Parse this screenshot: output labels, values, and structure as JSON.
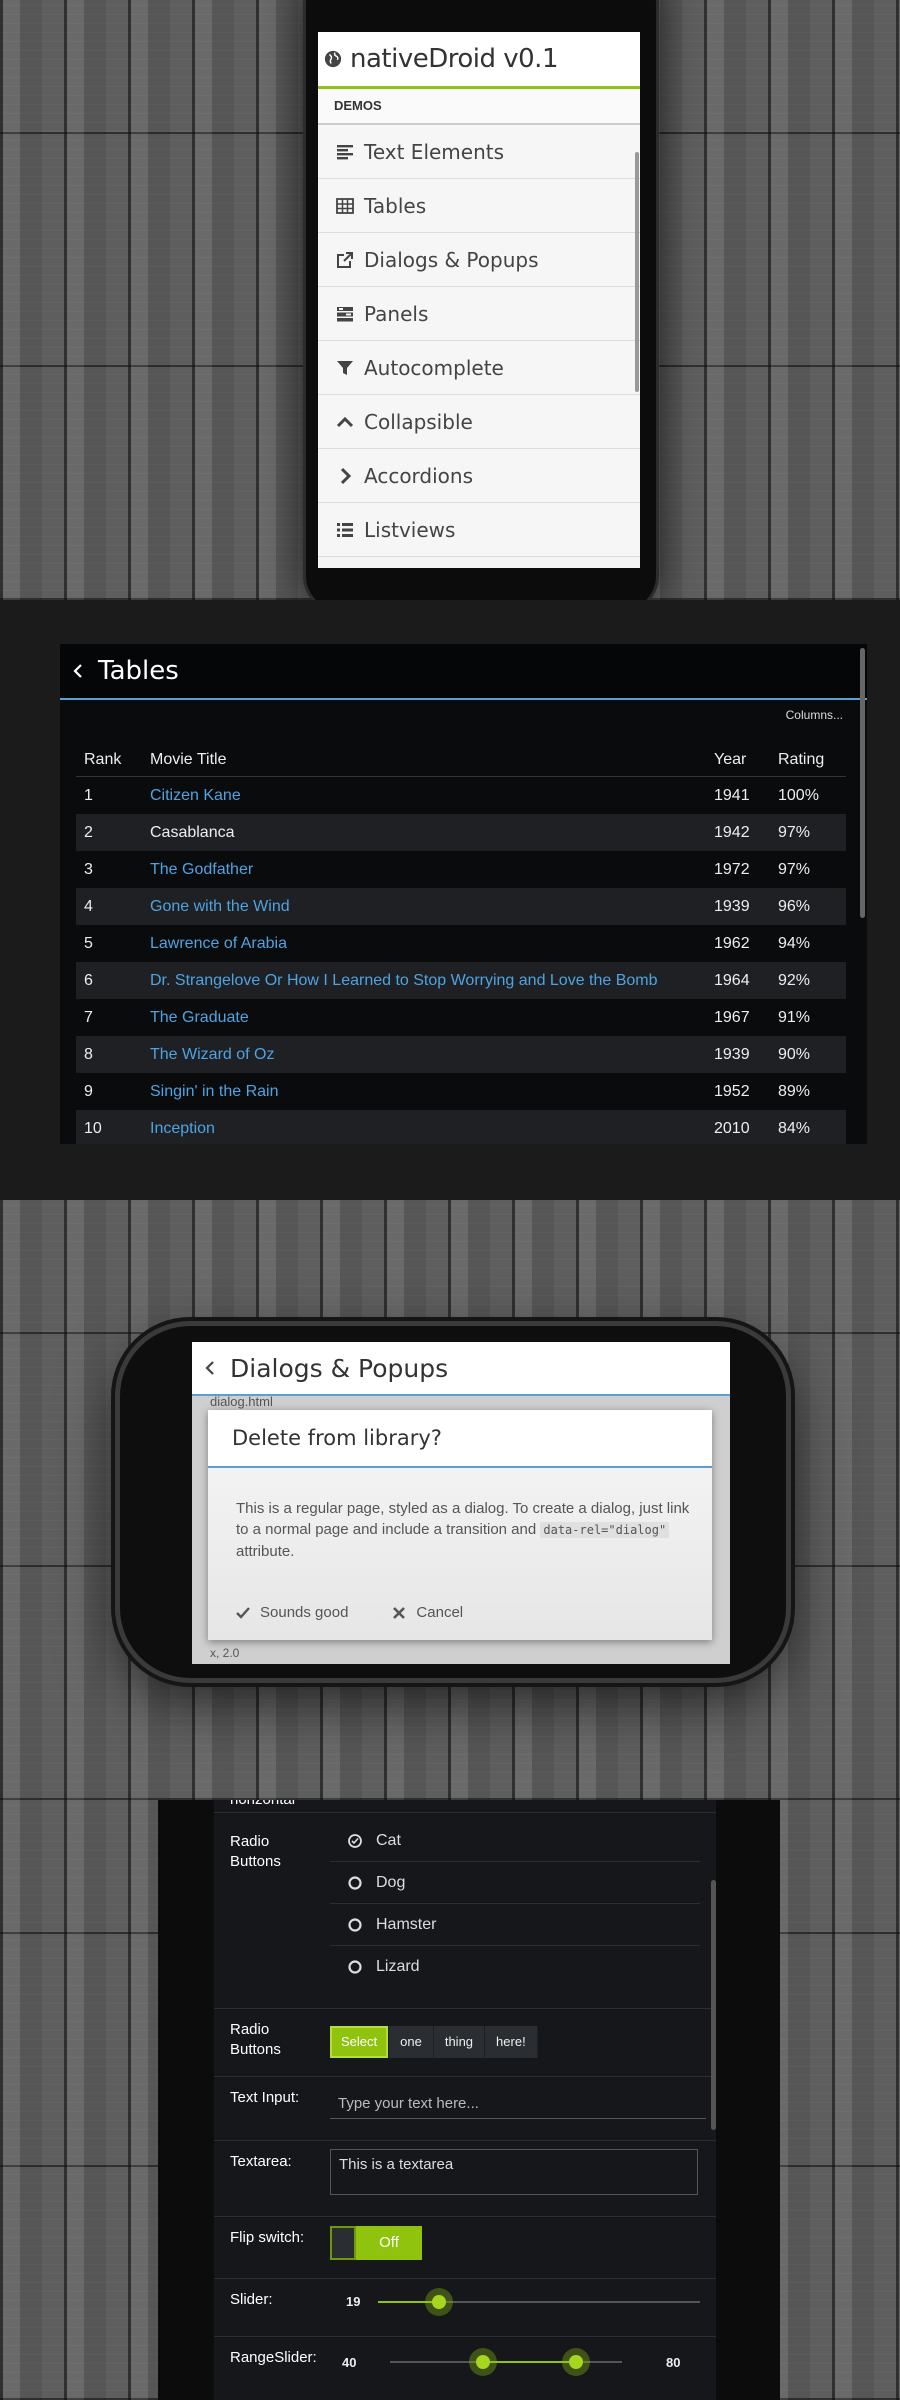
{
  "panel1": {
    "app_title": "nativeDroid v0.1",
    "section_label": "DEMOS",
    "menu_items": [
      {
        "label": "Text Elements",
        "icon": "align-left-icon"
      },
      {
        "label": "Tables",
        "icon": "table-icon"
      },
      {
        "label": "Dialogs & Popups",
        "icon": "external-link-icon"
      },
      {
        "label": "Panels",
        "icon": "panels-icon"
      },
      {
        "label": "Autocomplete",
        "icon": "filter-icon"
      },
      {
        "label": "Collapsible",
        "icon": "chevron-up-icon"
      },
      {
        "label": "Accordions",
        "icon": "chevron-right-icon"
      },
      {
        "label": "Listviews",
        "icon": "list-icon"
      }
    ],
    "accent_color": "#8fc30e"
  },
  "panel2": {
    "title": "Tables",
    "columns_button": "Columns...",
    "headers": [
      "Rank",
      "Movie Title",
      "Year",
      "Rating"
    ],
    "rows": [
      {
        "rank": "1",
        "title": "Citizen Kane",
        "year": "1941",
        "rating": "100%",
        "link": true
      },
      {
        "rank": "2",
        "title": "Casablanca",
        "year": "1942",
        "rating": "97%",
        "link": false
      },
      {
        "rank": "3",
        "title": "The Godfather",
        "year": "1972",
        "rating": "97%",
        "link": true
      },
      {
        "rank": "4",
        "title": "Gone with the Wind",
        "year": "1939",
        "rating": "96%",
        "link": true
      },
      {
        "rank": "5",
        "title": "Lawrence of Arabia",
        "year": "1962",
        "rating": "94%",
        "link": true
      },
      {
        "rank": "6",
        "title": "Dr. Strangelove Or How I Learned to Stop Worrying and Love the Bomb",
        "year": "1964",
        "rating": "92%",
        "link": true
      },
      {
        "rank": "7",
        "title": "The Graduate",
        "year": "1967",
        "rating": "91%",
        "link": true
      },
      {
        "rank": "8",
        "title": "The Wizard of Oz",
        "year": "1939",
        "rating": "90%",
        "link": true
      },
      {
        "rank": "9",
        "title": "Singin' in the Rain",
        "year": "1952",
        "rating": "89%",
        "link": true
      },
      {
        "rank": "10",
        "title": "Inception",
        "year": "2010",
        "rating": "84%",
        "link": true
      }
    ],
    "link_color": "#4fa3e0"
  },
  "panel3": {
    "page_title": "Dialogs & Popups",
    "bg_text_top": "dialog.html",
    "bg_text_bottom": "x, 2.0",
    "dialog_title": "Delete from library?",
    "dialog_text_1": "This is a regular page, styled as a dialog. To create a dialog, just link to a normal page and include a transition and ",
    "dialog_code_1": "data-rel=\"dialog\"",
    "dialog_text_2": " attribute.",
    "confirm_label": "Sounds good",
    "cancel_label": "Cancel"
  },
  "panel4": {
    "top_clip_label": "horizontal",
    "radio_label": "Radio Buttons",
    "radio_options": [
      "Cat",
      "Dog",
      "Hamster",
      "Lizard"
    ],
    "radio_selected": "Cat",
    "segmented_label": "Radio Buttons",
    "segmented_options": [
      "Select",
      "one",
      "thing",
      "here!"
    ],
    "segmented_selected": "Select",
    "text_input_label": "Text Input:",
    "text_input_placeholder": "Type your text here...",
    "textarea_label": "Textarea:",
    "textarea_value": "This is a textarea",
    "flip_label": "Flip switch:",
    "flip_value": "Off",
    "slider_label": "Slider:",
    "slider_value": "19",
    "slider_fraction": 0.19,
    "range_label": "RangeSlider:",
    "range_min": "40",
    "range_max": "80",
    "range_low_fraction": 0.4,
    "range_high_fraction": 0.8
  }
}
